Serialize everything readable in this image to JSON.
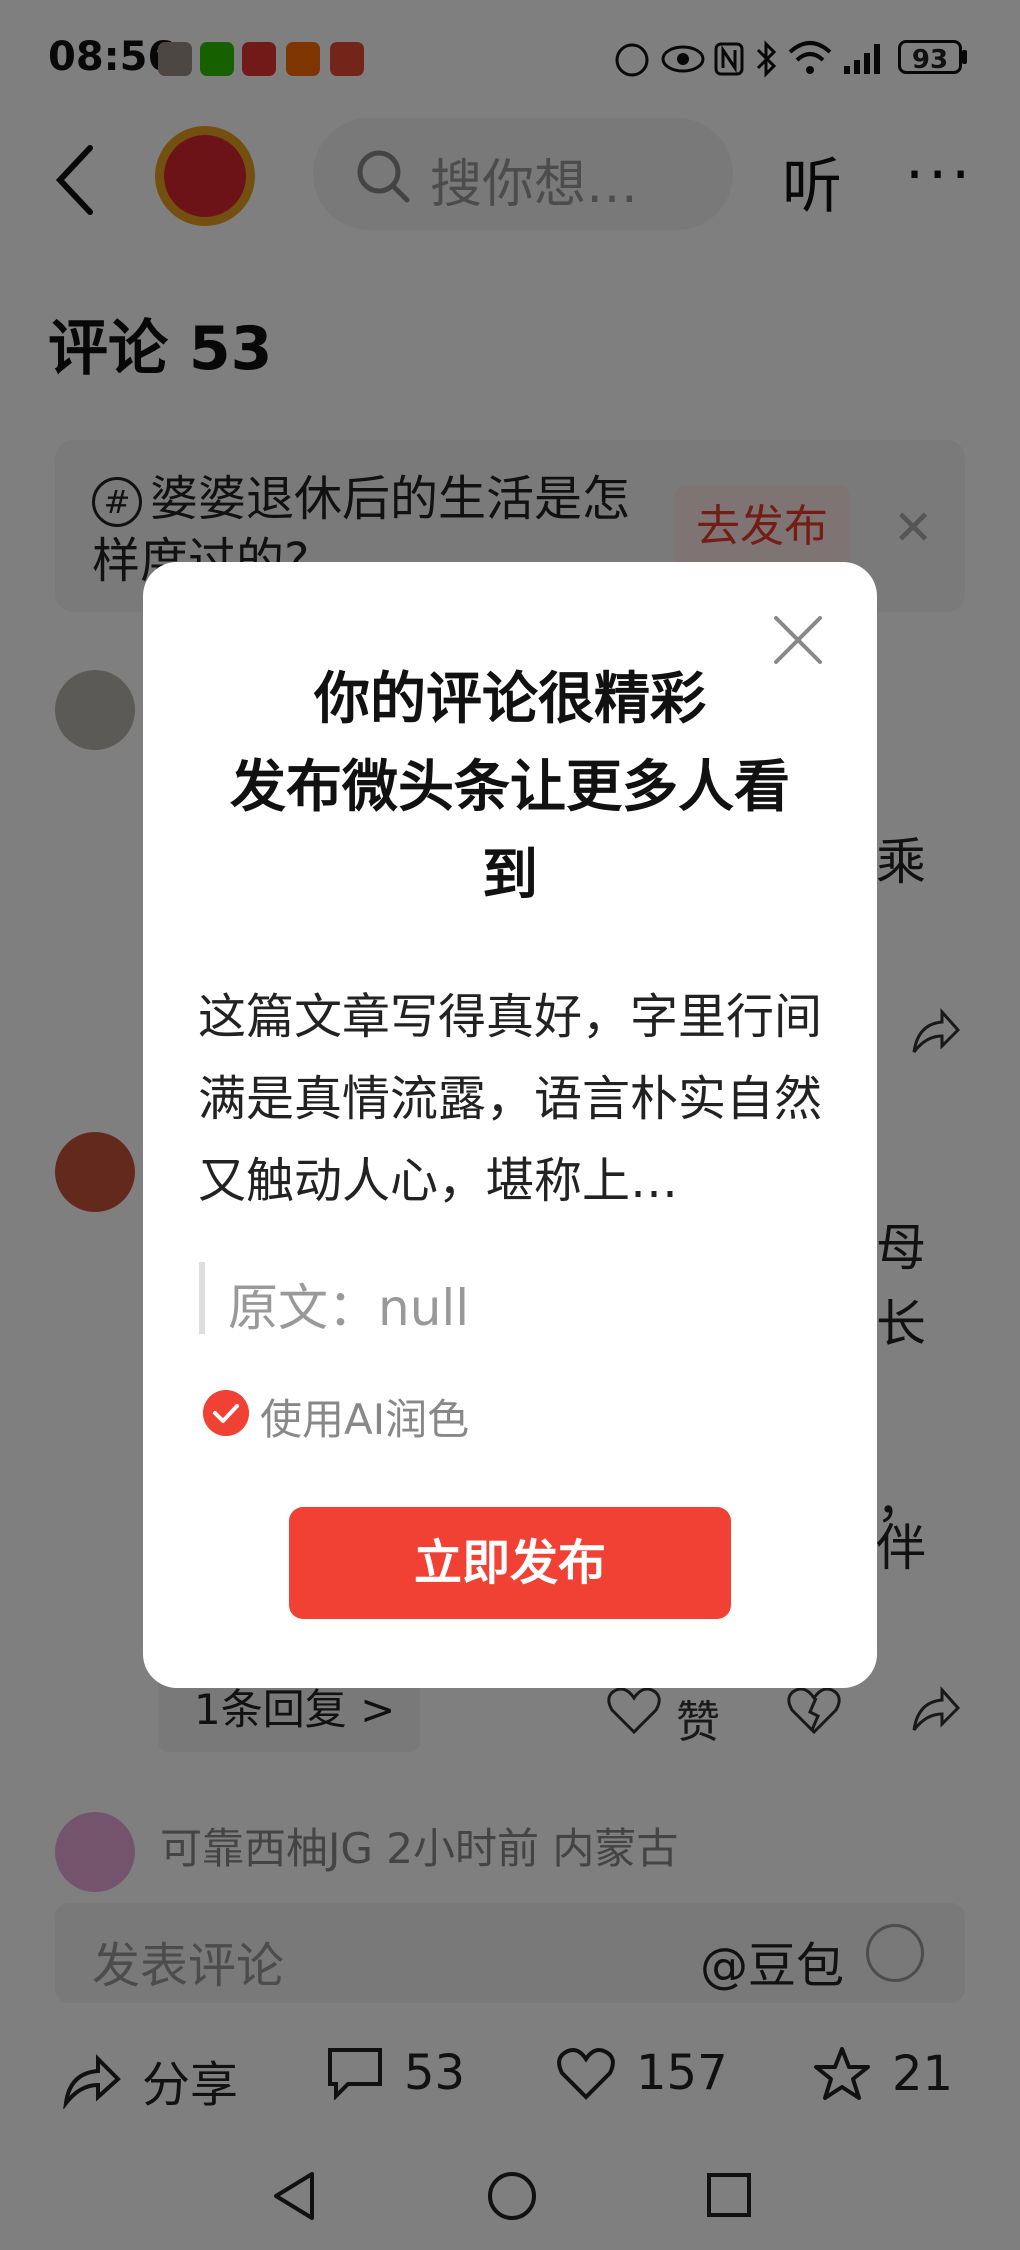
{
  "status_bar": {
    "time": "08:56",
    "battery": "93",
    "app_icons": [
      "avatar-app-icon",
      "wechat-icon",
      "toutiao-icon",
      "taobao-icon",
      "news-icon"
    ],
    "right_icons": [
      "hd-icon",
      "eye-icon",
      "nfc-icon",
      "bluetooth-icon",
      "wifi-icon",
      "signal-icon"
    ]
  },
  "header": {
    "search_placeholder": "搜你想…",
    "listen_label": "听",
    "more_label": "···"
  },
  "comments": {
    "title": "评论 53"
  },
  "topic": {
    "text": "婆婆退休后的生活是怎样度过的?",
    "button": "去发布"
  },
  "background": {
    "fragments": [
      "乘",
      "母",
      "长",
      "，",
      "伴"
    ],
    "reply_chip": "1条回复 >",
    "like_label": "赞",
    "next_comment_meta": "可靠西柚JG  2小时前  内蒙古"
  },
  "bottom_bar": {
    "input_placeholder": "发表评论",
    "doubao": "@豆包",
    "share_label": "分享",
    "comments_count": "53",
    "likes_count": "157",
    "favorites_count": "21"
  },
  "dialog": {
    "title_line1": "你的评论很精彩",
    "title_line2": "发布微头条让更多人看",
    "title_line3": "到",
    "body": "这篇文章写得真好，字里行间满是真情流露，语言朴实自然又触动人心，堪称上…",
    "original_label": "原文：null",
    "ai_polish_label": "使用AI润色",
    "publish_button": "立即发布"
  },
  "colors": {
    "accent_red": "#f04134",
    "overlay": "rgba(0,0,0,0.5)"
  }
}
